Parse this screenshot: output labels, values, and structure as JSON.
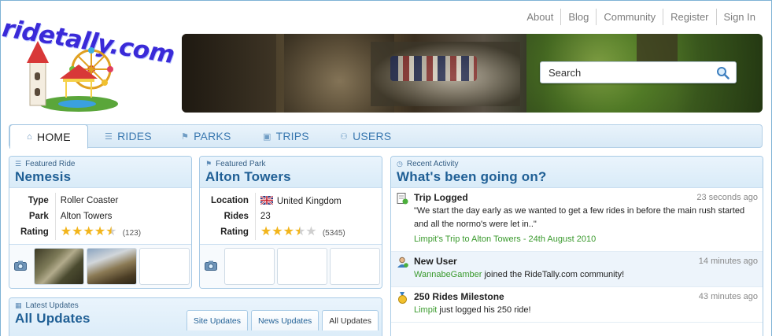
{
  "logo": {
    "text": "ridetally.com"
  },
  "top_nav": [
    "About",
    "Blog",
    "Community",
    "Register",
    "Sign In"
  ],
  "search": {
    "placeholder": "Search"
  },
  "main_nav": [
    {
      "label": "HOME",
      "icon": "home-icon",
      "active": true
    },
    {
      "label": "RIDES",
      "icon": "coaster-icon",
      "active": false
    },
    {
      "label": "PARKS",
      "icon": "flag-icon",
      "active": false
    },
    {
      "label": "TRIPS",
      "icon": "suitcase-icon",
      "active": false
    },
    {
      "label": "USERS",
      "icon": "user-icon",
      "active": false
    }
  ],
  "featured_ride": {
    "kicker": "Featured Ride",
    "title": "Nemesis",
    "type_label": "Type",
    "type_value": "Roller Coaster",
    "park_label": "Park",
    "park_value": "Alton Towers",
    "rating_label": "Rating",
    "rating_stars": 4.5,
    "rating_count": "(123)"
  },
  "featured_park": {
    "kicker": "Featured Park",
    "title": "Alton Towers",
    "location_label": "Location",
    "location_value": "United Kingdom",
    "rides_label": "Rides",
    "rides_value": "23",
    "rating_label": "Rating",
    "rating_stars": 3.5,
    "rating_count": "(5345)"
  },
  "latest_updates": {
    "kicker": "Latest Updates",
    "title": "All Updates",
    "tabs": [
      "Site Updates",
      "News Updates",
      "All Updates"
    ],
    "active_tab": "All Updates"
  },
  "recent_activity": {
    "kicker": "Recent Activity",
    "title": "What's been going on?",
    "items": [
      {
        "icon": "trip-log-icon",
        "title": "Trip Logged",
        "time": "23 seconds ago",
        "body": "\"We start the day early as we wanted to get a few rides in before the main rush started and all the normo's were let in..\"",
        "link": "Limpit's Trip to Alton Towers - 24th August 2010"
      },
      {
        "icon": "new-user-icon",
        "title": "New User",
        "time": "14 minutes ago",
        "link": "WannabeGamber",
        "body": " joined the RideTally.com community!"
      },
      {
        "icon": "medal-icon",
        "title": "250 Rides Milestone",
        "time": "43 minutes ago",
        "link": "Limpit",
        "body": " just logged his 250 ride!"
      }
    ]
  },
  "colors": {
    "accent": "#1f5f95",
    "link_green": "#3a9a2d",
    "star": "#f2b51c"
  }
}
